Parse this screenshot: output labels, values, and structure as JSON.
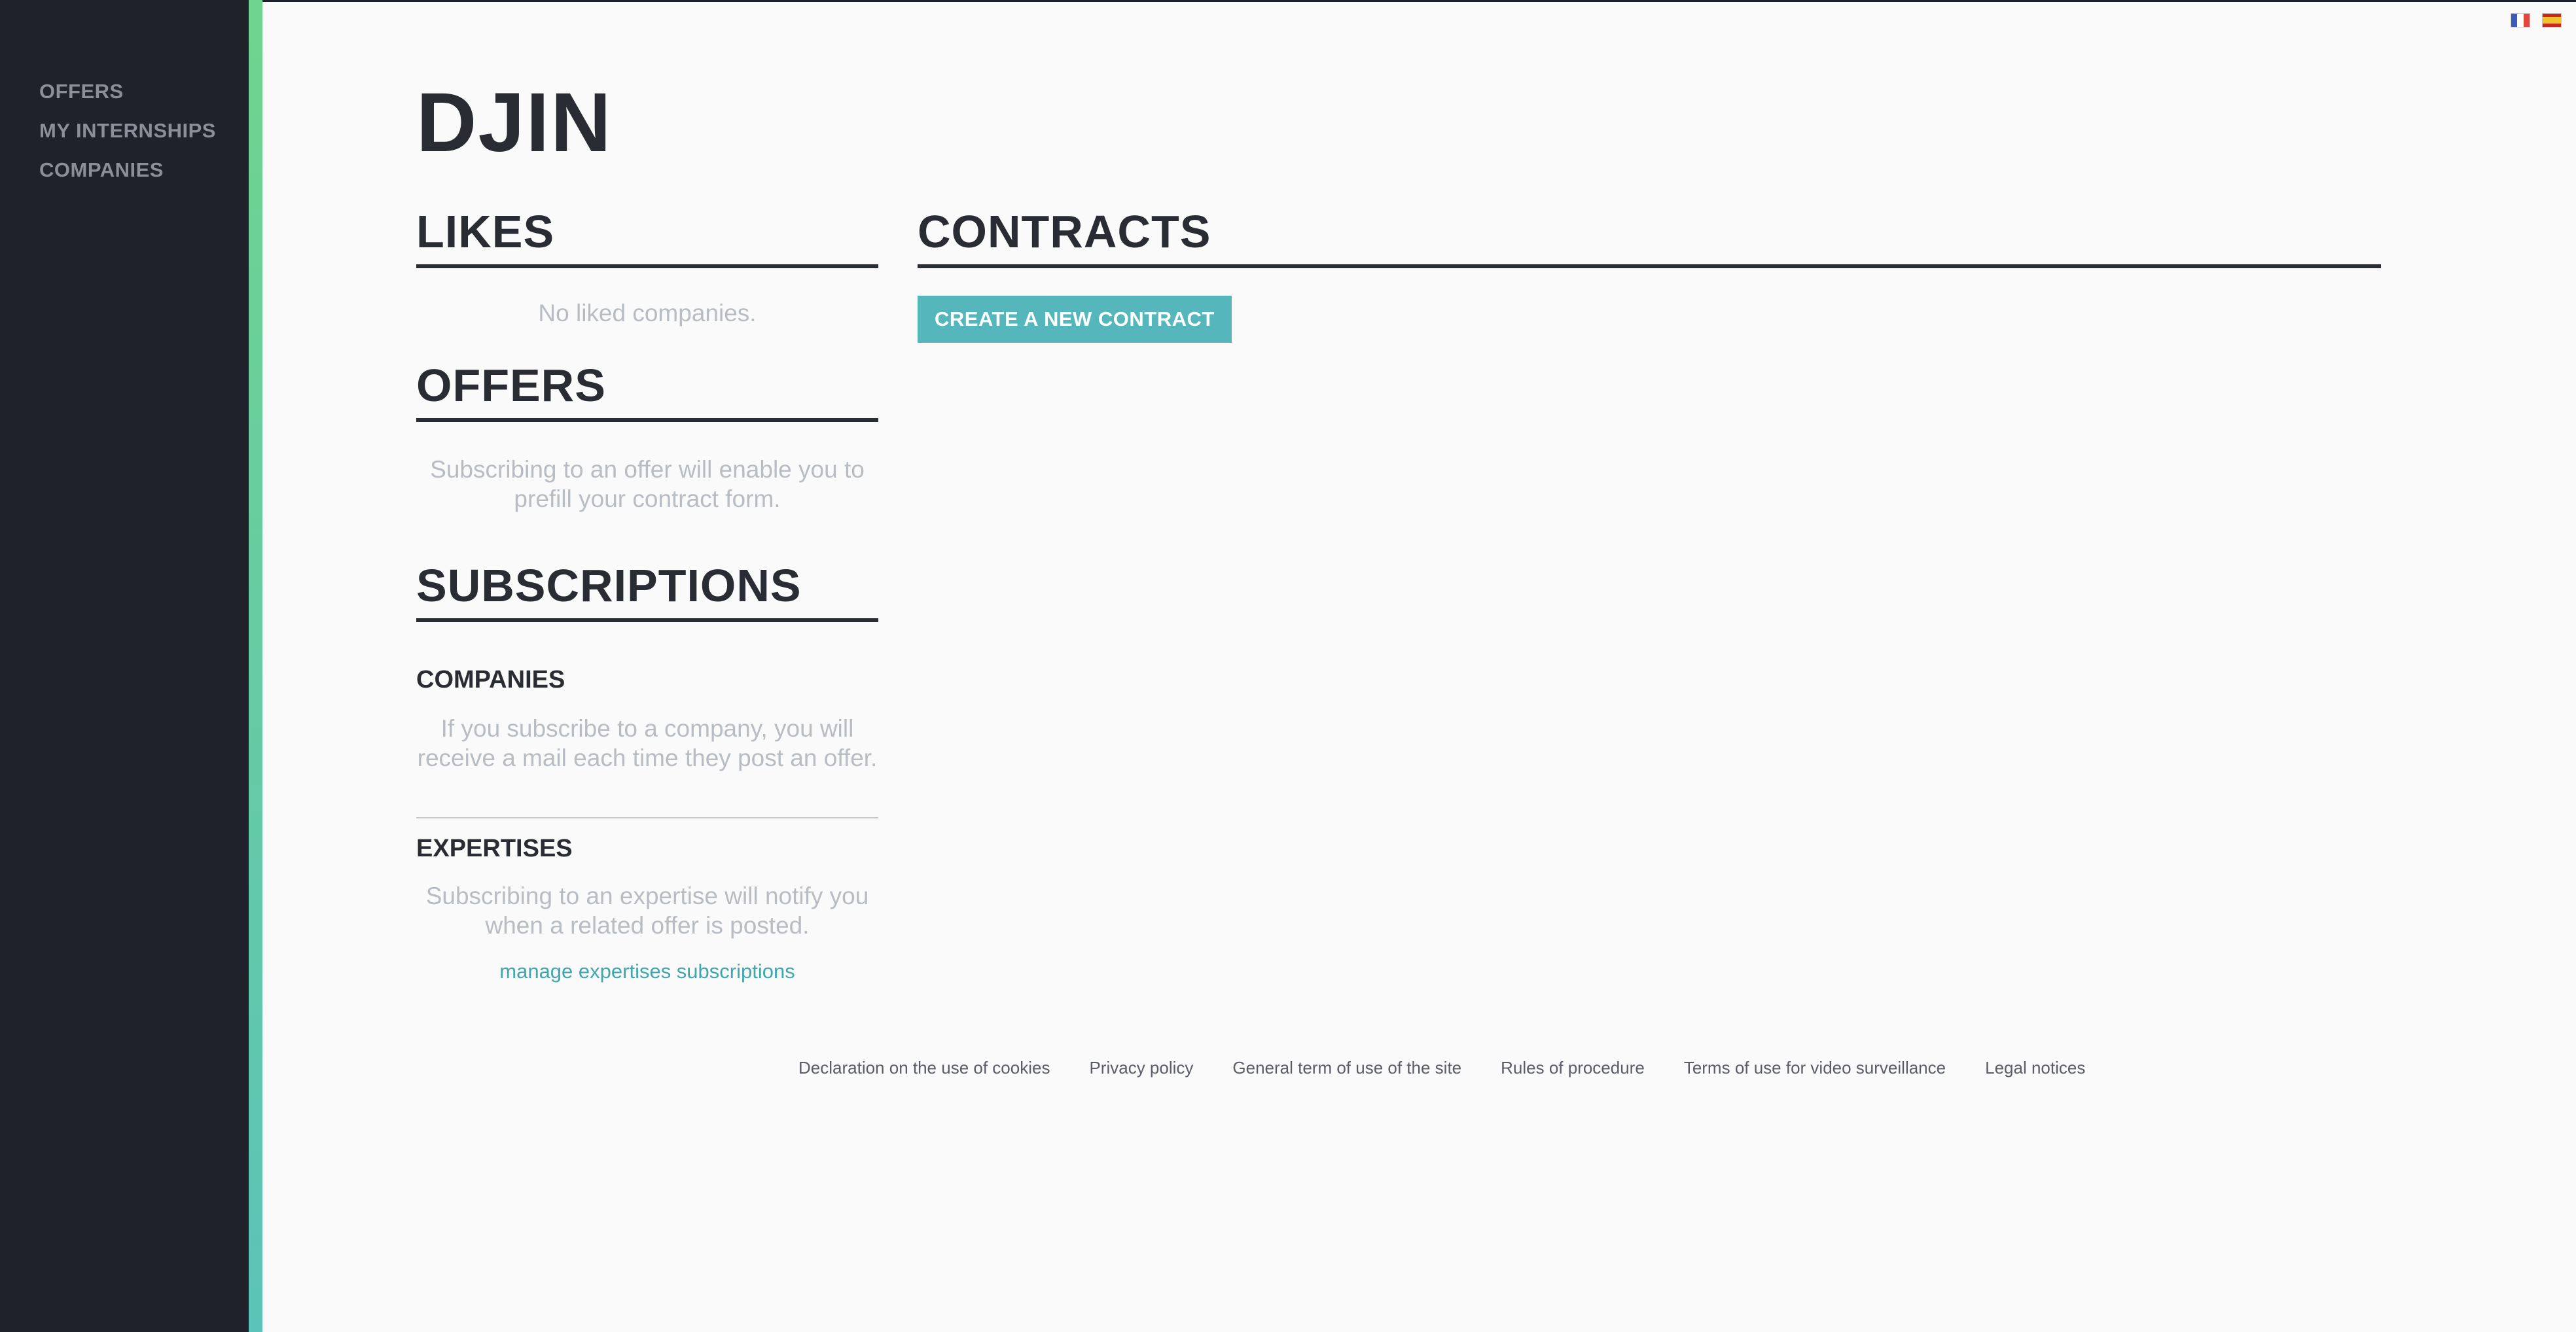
{
  "sidebar": {
    "items": [
      {
        "label": "OFFERS"
      },
      {
        "label": "MY INTERNSHIPS"
      },
      {
        "label": "COMPANIES"
      }
    ]
  },
  "languages": [
    "fr-flag-icon",
    "es-flag-icon"
  ],
  "page": {
    "title": "DJIN"
  },
  "likes": {
    "heading": "LIKES",
    "empty_text": "No liked companies."
  },
  "offers": {
    "heading": "OFFERS",
    "text": "Subscribing to an offer will enable you to prefill your contract form."
  },
  "subscriptions": {
    "heading": "SUBSCRIPTIONS",
    "companies": {
      "heading": "COMPANIES",
      "text": "If you subscribe to a company, you will receive a mail each time they post an offer."
    },
    "expertises": {
      "heading": "EXPERTISES",
      "text": "Subscribing to an expertise will notify you when a related offer is posted.",
      "manage_link": "manage expertises subscriptions"
    }
  },
  "contracts": {
    "heading": "CONTRACTS",
    "create_button": "CREATE A NEW CONTRACT"
  },
  "footer": {
    "links": [
      "Declaration on the use of cookies",
      "Privacy policy",
      "General term of use of the site",
      "Rules of procedure",
      "Terms of use for video surveillance",
      "Legal notices"
    ]
  },
  "colors": {
    "sidebar_bg": "#1f222b",
    "accent_top": "#6fd48e",
    "accent_bottom": "#5cc3b8",
    "button": "#55b7bb",
    "link": "#40a7ae",
    "heading": "#2a2c34",
    "muted_text": "#b8bcc3"
  }
}
